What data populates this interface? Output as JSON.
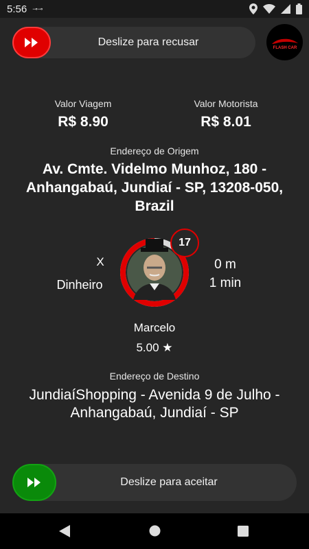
{
  "status": {
    "time": "5:56"
  },
  "reject": {
    "label": "Deslize para recusar"
  },
  "accept": {
    "label": "Deslize para aceitar"
  },
  "logo": {
    "text": "FLASH CAR"
  },
  "trip": {
    "value_label": "Valor Viagem",
    "value": "R$ 8.90",
    "driver_label": "Valor Motorista",
    "driver_value": "R$ 8.01"
  },
  "origin": {
    "label": "Endereço de Origem",
    "address": "Av. Cmte. Videlmo Munhoz, 180 - Anhangabaú, Jundiaí - SP, 13208-050, Brazil"
  },
  "rider": {
    "x_mark": "X",
    "payment": "Dinheiro",
    "countdown": "17",
    "distance": "0 m",
    "eta": "1 min",
    "name": "Marcelo",
    "rating": "5.00 ★",
    "timer_progress": 0.85
  },
  "destination": {
    "label": "Endereço de Destino",
    "address": "JundiaíShopping - Avenida 9 de Julho - Anhangabaú, Jundiaí - SP"
  },
  "colors": {
    "reject": "#e00000",
    "accept": "#0a8a0a",
    "background": "#262626"
  }
}
